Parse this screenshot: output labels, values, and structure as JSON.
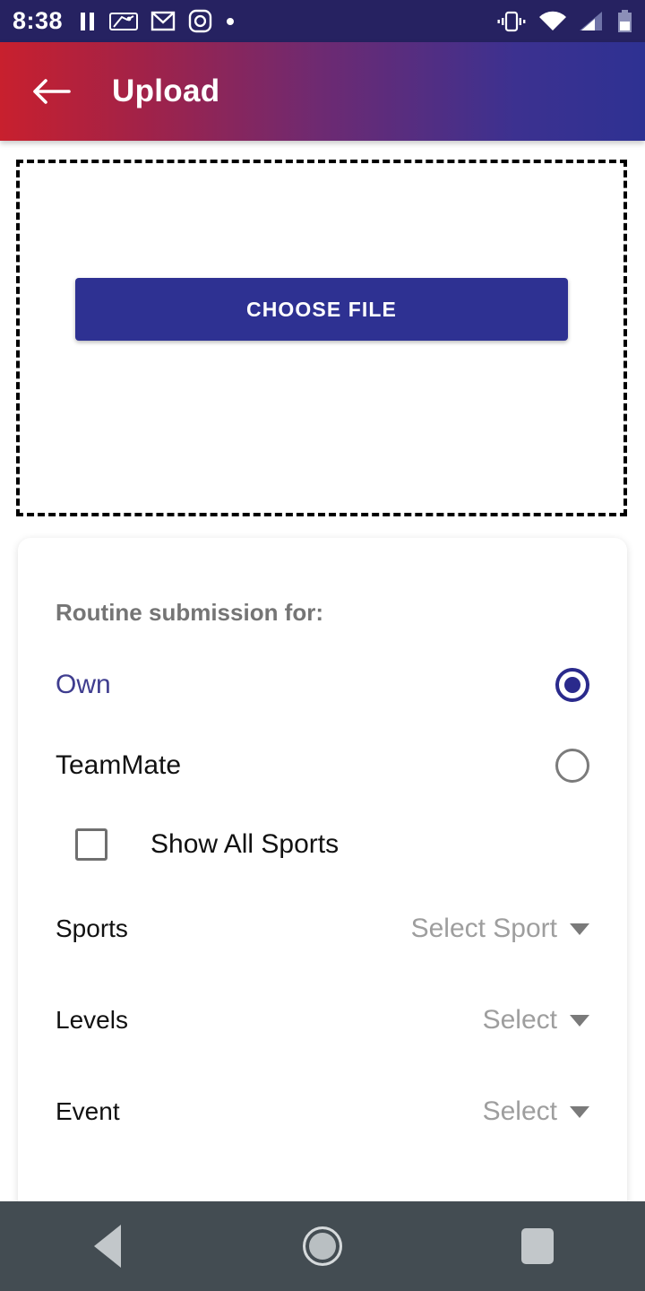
{
  "status_bar": {
    "time": "8:38",
    "left_icons": [
      "pause-icon",
      "mlb-icon",
      "gmail-icon",
      "instagram-icon",
      "dot-icon"
    ],
    "right_icons": [
      "vibrate-icon",
      "wifi-icon",
      "cellular-signal-icon",
      "battery-icon"
    ],
    "background_color": "#262261"
  },
  "app_bar": {
    "title": "Upload",
    "back_icon": "back-arrow-icon",
    "gradient_from": "#c8202e",
    "gradient_to": "#2e3192"
  },
  "dropzone": {
    "choose_file_label": "CHOOSE FILE",
    "button_color": "#2e3192",
    "border_style": "dashed"
  },
  "form": {
    "section_label": "Routine submission for:",
    "radio_options": [
      {
        "label": "Own",
        "selected": true
      },
      {
        "label": "TeamMate",
        "selected": false
      }
    ],
    "checkbox": {
      "label": "Show All Sports",
      "checked": false
    },
    "fields": [
      {
        "label": "Sports",
        "value": "Select Sport"
      },
      {
        "label": "Levels",
        "value": "Select"
      },
      {
        "label": "Event",
        "value": "Select"
      }
    ],
    "selected_color": "#3f3d8f",
    "placeholder_color": "#9e9e9e"
  },
  "nav_bar": {
    "buttons": [
      "back-triangle-icon",
      "home-circle-icon",
      "recents-square-icon"
    ],
    "background_color": "#434c52"
  }
}
